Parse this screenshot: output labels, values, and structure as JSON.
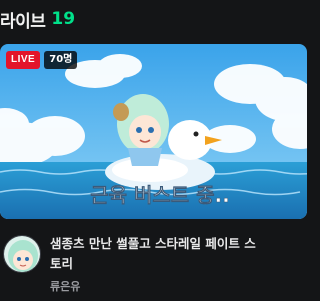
{
  "section": {
    "title": "라이브",
    "count": "19",
    "count_color": "#00e08a"
  },
  "stream": {
    "live_label": "LIVE",
    "viewers": "70명",
    "overlay_caption": "근육 버스트 중..",
    "title_line1": "샘종츠 만난 썰풀고 스타레일 페이트 스",
    "title_line2": "토리",
    "channel_name": "류은유",
    "live_color": "#e3142a"
  }
}
